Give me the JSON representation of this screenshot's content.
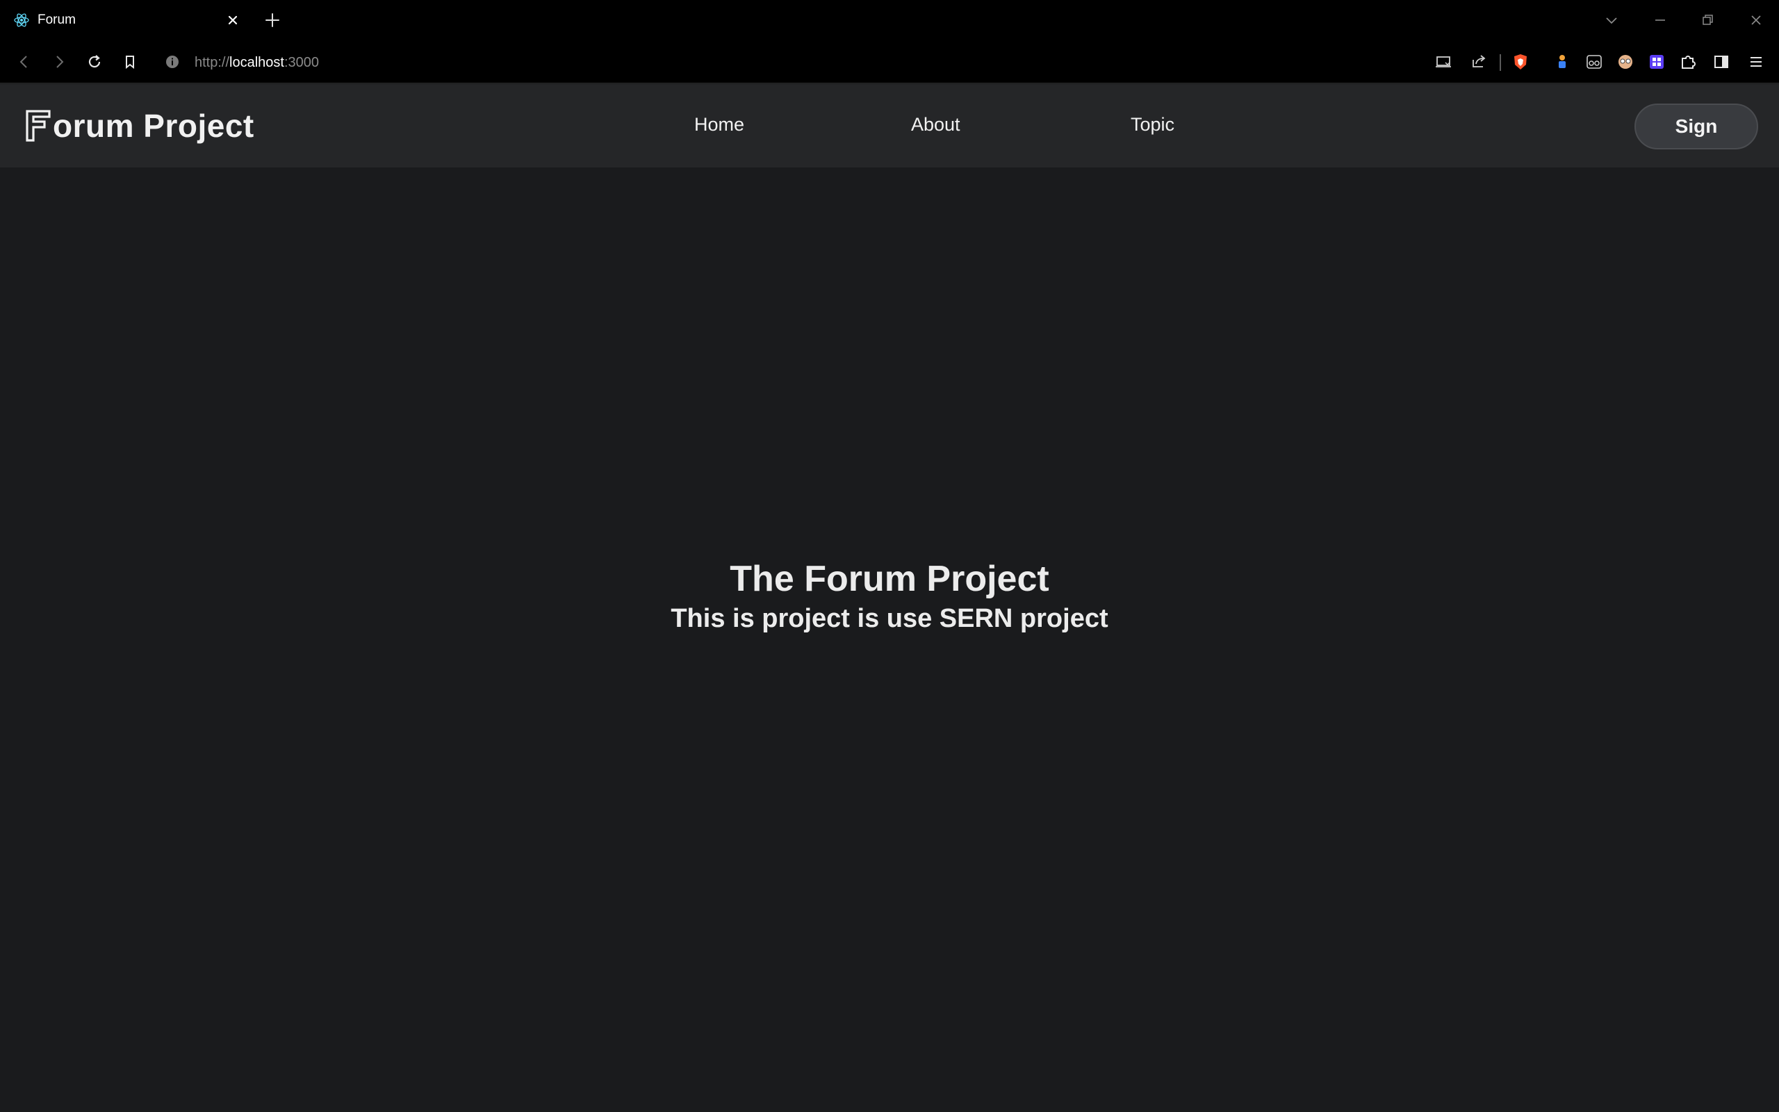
{
  "browser": {
    "tab": {
      "title": "Forum",
      "favicon": "react-icon"
    },
    "url": {
      "scheme": "http://",
      "host": "localhost",
      "port": ":3000"
    }
  },
  "site": {
    "logo_text": "orum Project",
    "nav": {
      "items": [
        {
          "label": "Home"
        },
        {
          "label": "About"
        },
        {
          "label": "Topic"
        }
      ]
    },
    "sign_label": "Sign"
  },
  "hero": {
    "title": "The Forum Project",
    "subtitle": "This is project is use SERN project"
  },
  "colors": {
    "page_background": "#1a1b1d",
    "navbar_background": "#252628",
    "chrome_background": "#000000",
    "text": "#ececec",
    "button_background": "#393b3f"
  }
}
